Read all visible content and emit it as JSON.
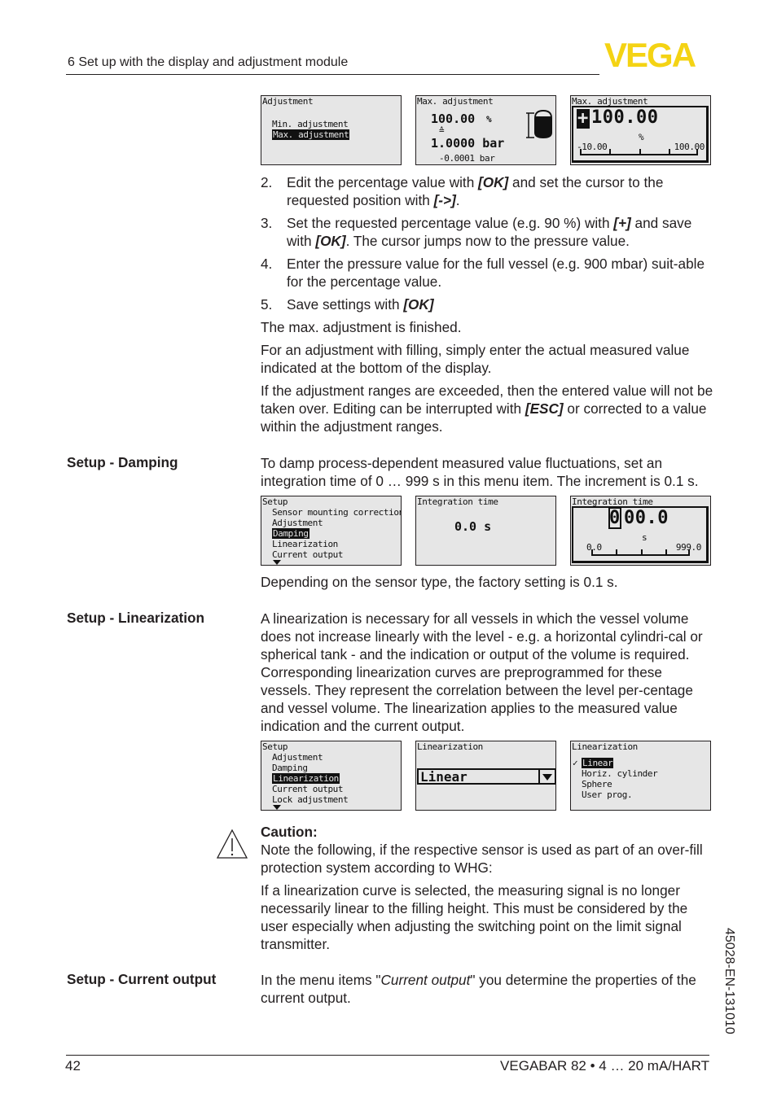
{
  "header": {
    "section_title": "6 Set up with the display and adjustment module",
    "logo_text": "VEGA",
    "logo_color": "#f4d314"
  },
  "max_adjustment": {
    "displays": [
      {
        "title": "Adjustment",
        "items": [
          "Min. adjustment",
          "Max. adjustment"
        ],
        "selected": "Max. adjustment"
      },
      {
        "title": "Max. adjustment",
        "percent": "100.00",
        "percent_unit": "%",
        "equiv_symbol": "≙",
        "pressure": "1.0000 bar",
        "measured": "-0.0001 bar",
        "icon": "vessel-full-icon"
      },
      {
        "title": "Max. adjustment",
        "cursor_char": "+",
        "value": "100.00",
        "unit": "%",
        "range_min": "-10.00",
        "range_max": "100.00"
      }
    ],
    "steps": [
      {
        "num": "2.",
        "parts": [
          "Edit the percentage value with ",
          "[OK]",
          " and set the cursor to the requested position with ",
          "[->]",
          "."
        ]
      },
      {
        "num": "3.",
        "parts": [
          "Set the requested percentage value (e.g. 90 %) with ",
          "[+]",
          " and save with ",
          "[OK]",
          ". The cursor jumps now to the pressure value."
        ]
      },
      {
        "num": "4.",
        "parts": [
          "Enter the pressure value for the full vessel (e.g. 900 mbar) suit-able for the percentage value."
        ]
      },
      {
        "num": "5.",
        "parts": [
          "Save settings with ",
          "[OK]"
        ]
      }
    ],
    "finished": "The max. adjustment is finished.",
    "filling_note": "For an adjustment with filling, simply enter the actual measured value indicated at the bottom of the display.",
    "range_note_parts": [
      "If the adjustment ranges are exceeded, then the entered value will not be taken over. Editing can be interrupted with ",
      "[ESC]",
      " or corrected to a value within the adjustment ranges."
    ]
  },
  "damping": {
    "label": "Setup - Damping",
    "intro": "To damp process-dependent measured value fluctuations, set an integration time of 0 … 999 s in this menu item. The increment is 0.1 s.",
    "displays": [
      {
        "title": "Setup",
        "items": [
          "Sensor mounting correction",
          "Adjustment",
          "Damping",
          "Linearization",
          "Current output"
        ],
        "selected": "Damping"
      },
      {
        "title": "Integration time",
        "value": "0.0 s"
      },
      {
        "title": "Integration time",
        "cursor_char": "0",
        "value": "00.0",
        "unit": "s",
        "range_min": "0.0",
        "range_max": "999.0"
      }
    ],
    "note": "Depending on the sensor type, the factory setting is 0.1 s."
  },
  "linearization": {
    "label": "Setup - Linearization",
    "intro": "A linearization is necessary for all vessels in which the vessel volume does not increase linearly with the level - e.g. a horizontal cylindri-cal or spherical tank - and the indication or output of the volume is required. Corresponding linearization curves are preprogrammed for these vessels. They represent the correlation between the level per-centage and vessel volume. The linearization applies to the measured value indication and the current output.",
    "displays": [
      {
        "title": "Setup",
        "items": [
          "Adjustment",
          "Damping",
          "Linearization",
          "Current output",
          "Lock adjustment"
        ],
        "selected": "Linearization"
      },
      {
        "title": "Linearization",
        "selected_value": "Linear"
      },
      {
        "title": "Linearization",
        "options": [
          "Linear",
          "Horiz. cylinder",
          "Sphere",
          "User prog."
        ],
        "checked": "Linear"
      }
    ],
    "caution": {
      "title": "Caution:",
      "text": "Note the following, if the respective sensor is used as part of an over-fill protection system according to WHG:",
      "text2": "If a linearization curve is selected, the measuring signal is no longer necessarily linear to the filling height. This must be considered by the user especially when adjusting the switching point on the limit signal transmitter."
    }
  },
  "current_output": {
    "label": "Setup - Current output",
    "parts": [
      "In the menu items \"",
      "Current output",
      "\" you determine the properties of the current output."
    ]
  },
  "footer": {
    "page_number": "42",
    "product": "VEGABAR 82 • 4 … 20 mA/HART",
    "doc_code": "45028-EN-131010"
  }
}
